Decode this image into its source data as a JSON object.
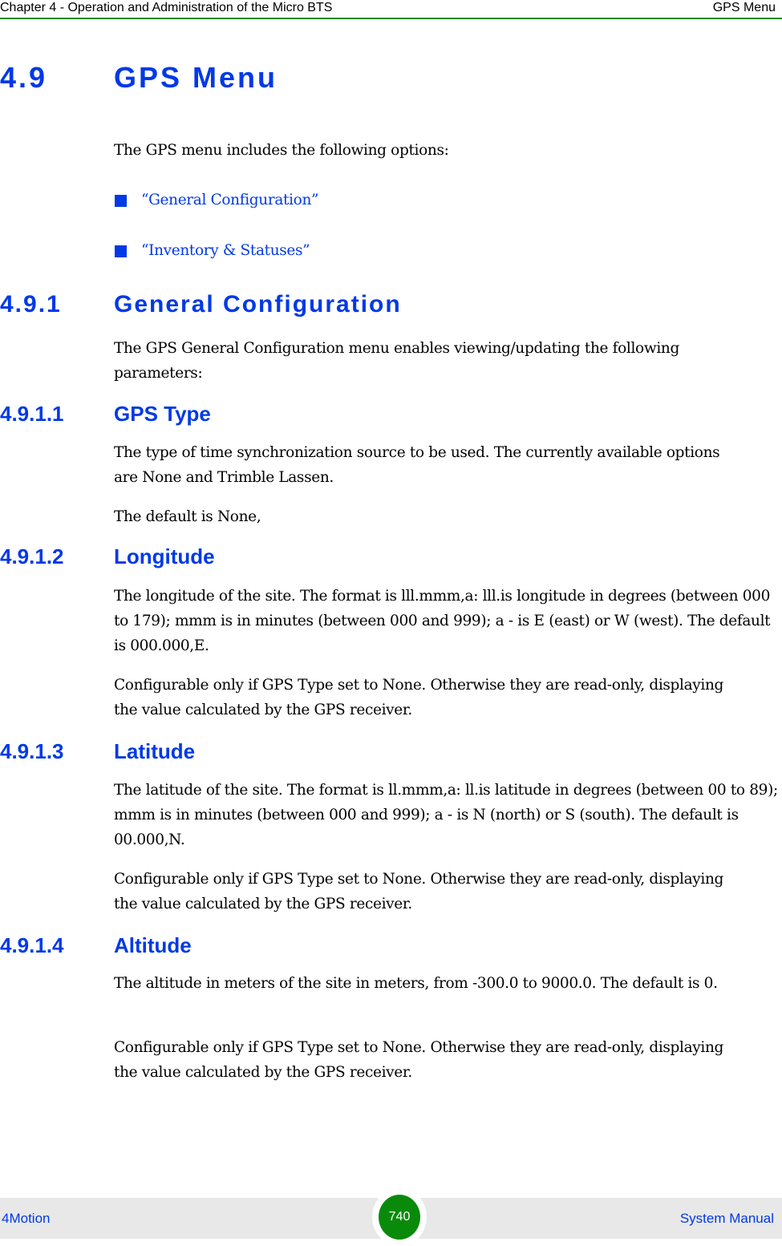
{
  "header": {
    "chapter": "Chapter 4 - Operation and Administration of the Micro BTS",
    "section": "GPS Menu"
  },
  "section": {
    "number": "4.9",
    "title": "GPS Menu",
    "intro": "The GPS menu includes the following options:",
    "options": [
      {
        "label": "“General Configuration”"
      },
      {
        "label": "“Inventory & Statuses”"
      }
    ]
  },
  "subsection": {
    "number": "4.9.1",
    "title": "General Configuration",
    "intro": "The GPS General Configuration menu enables viewing/updating the following parameters:"
  },
  "parameters": [
    {
      "number": "4.9.1.1",
      "title": "GPS Type",
      "paragraphs": [
        "The type of time synchronization source to be used. The currently available options are None and Trimble Lassen.",
        "The default is None,"
      ]
    },
    {
      "number": "4.9.1.2",
      "title": "Longitude",
      "paragraphs": [
        "The longitude of the site. The format is lll.mmm,a: lll.is longitude in degrees (between 000 to 179); mmm is in minutes (between 000 and 999); a - is E (east) or W (west). The default is 000.000,E.",
        "Configurable only if GPS Type set to None. Otherwise they are read-only, displaying the value calculated by the GPS receiver."
      ]
    },
    {
      "number": "4.9.1.3",
      "title": "Latitude",
      "paragraphs": [
        "The latitude of the site. The format is ll.mmm,a: ll.is latitude in degrees (between 00 to 89); mmm is in minutes (between 000 and 999); a - is N (north) or S (south). The default is 00.000,N.",
        "Configurable only if GPS Type set to None. Otherwise they are read-only, displaying the value calculated by the GPS receiver."
      ]
    },
    {
      "number": "4.9.1.4",
      "title": "Altitude",
      "paragraphs": [
        "The altitude in meters of the site in meters, from -300.0 to 9000.0. The default is 0.",
        "Configurable only if GPS Type set to None. Otherwise they are read-only, displaying the value calculated by the GPS receiver."
      ]
    }
  ],
  "footer": {
    "product": "4Motion",
    "page_number": "740",
    "manual": "System Manual"
  }
}
